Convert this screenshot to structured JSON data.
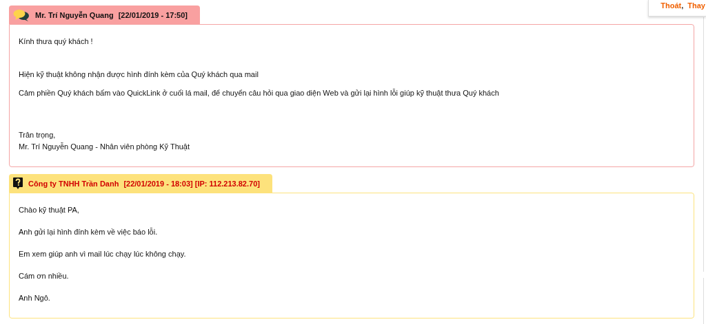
{
  "account_menu": {
    "links": [
      "Thoát",
      "Thay"
    ],
    "separator": ","
  },
  "messages": [
    {
      "kind": "staff",
      "author": "Mr. Trí Nguyễn Quang",
      "time": "[22/01/2019 - 17:50]",
      "paragraphs": [
        [
          "Kính thưa quý khách !"
        ],
        [
          "Hiện kỹ thuật không nhận được hình đính kèm của Quý khách qua mail"
        ],
        [
          "Cảm phiền Quý khách bấm vào QuickLink ở cuối lá mail, để chuyển câu hỏi qua giao diện Web và gửi lại hình lỗi giúp kỹ thuật thưa Quý khách"
        ],
        [
          "Trân trọng,",
          "Mr. Trí Nguyễn Quang - Nhân viên phòng Kỹ Thuật"
        ]
      ]
    },
    {
      "kind": "customer",
      "author": "Công ty TNHH Trần Danh",
      "time": "[22/01/2019 - 18:03] [IP: 112.213.82.70]",
      "paragraphs": [
        [
          "Chào kỹ thuật PA,"
        ],
        [
          "Anh gửi lại hình đính kèm về việc báo lỗi."
        ],
        [
          "Em xem giúp anh vì mail lúc chạy lúc không chạy."
        ],
        [
          "Cám ơn nhiều."
        ],
        [
          "Anh Ngô."
        ]
      ]
    }
  ]
}
